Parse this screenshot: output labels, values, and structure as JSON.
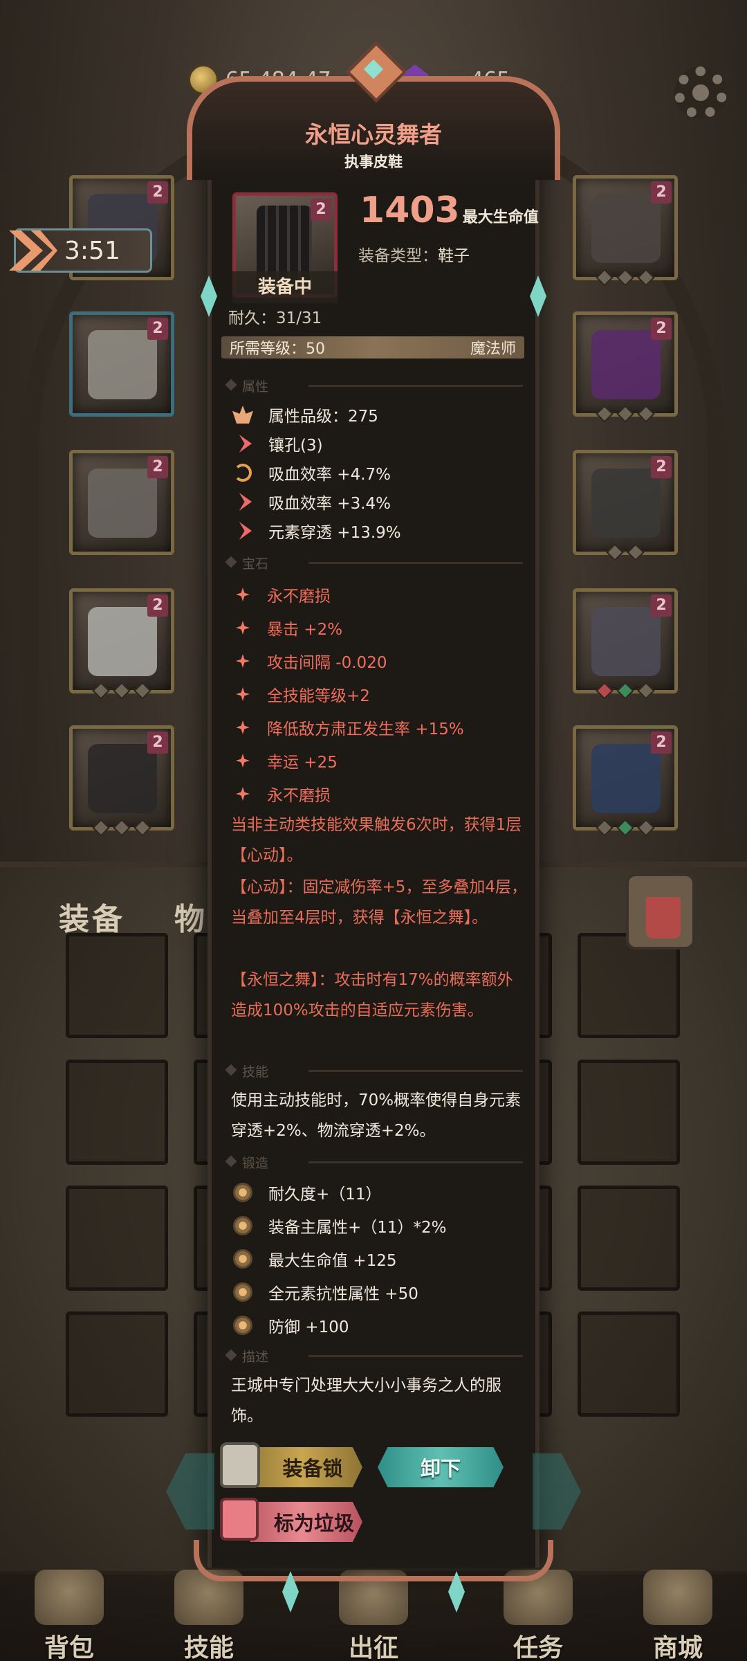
{
  "currency": {
    "gold": "65,484,47…",
    "gems": "465"
  },
  "timer": "3:51",
  "bag_tabs": {
    "equipment": "装备",
    "items": "物品"
  },
  "item": {
    "name": "永恒心灵舞者",
    "subtitle": "执事皮鞋",
    "tier": "2",
    "main_value": "1403",
    "main_label": "最大生命值",
    "type_label": "装备类型：",
    "type_value": "鞋子",
    "equipped_label": "装备中",
    "durability": "耐久：31/31",
    "req_level": "所需等级：50",
    "req_class": "魔法师"
  },
  "sections": {
    "attributes": "属性",
    "gems": "宝石",
    "skill": "技能",
    "forge": "锻造",
    "description": "描述"
  },
  "attributes": [
    {
      "icon": "lotus-icon",
      "text": "属性品级：275"
    },
    {
      "icon": "socket-icon",
      "text": "镶孔(3)"
    },
    {
      "icon": "cycle-icon",
      "text": "吸血效率 +4.7%"
    },
    {
      "icon": "rune-icon",
      "text": "吸血效率 +3.4%"
    },
    {
      "icon": "rune-icon",
      "text": "元素穿透 +13.9%"
    }
  ],
  "gems": [
    "永不磨损",
    "暴击 +2%",
    "攻击间隔 -0.020",
    "全技能等级+2",
    "降低敌方肃正发生率 +15%",
    "幸运 +25",
    "永不磨损"
  ],
  "effect_text": [
    "当非主动类技能效果触发6次时，获得1层【心动】。",
    "【心动】：固定减伤率+5，至多叠加4层，当叠加至4层时，获得【永恒之舞】。",
    "【永恒之舞】：攻击时有17%的概率额外造成100%攻击的自适应元素伤害。"
  ],
  "skill_text": "使用主动技能时，70%概率使得自身元素穿透+2%、物流穿透+2%。",
  "forge": [
    "耐久度+（11）",
    "装备主属性+（11）*2%",
    "最大生命值 +125",
    "全元素抗性属性 +50",
    "防御 +100"
  ],
  "description": "王城中专门处理大大小小事务之人的服饰。",
  "buttons": {
    "lock": "装备锁",
    "unequip": "卸下",
    "mark_trash": "标为垃圾"
  },
  "nav": [
    {
      "label": "背包"
    },
    {
      "label": "技能"
    },
    {
      "label": "出征"
    },
    {
      "label": "任务"
    },
    {
      "label": "商城"
    }
  ],
  "colors": {
    "accent": "#f0a08a",
    "gem_text": "#f06e5c",
    "teal": "#5fc0b2",
    "gold": "#c9a650"
  }
}
